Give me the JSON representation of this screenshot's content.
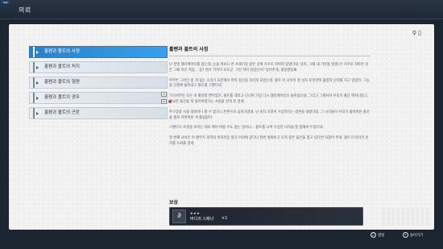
{
  "window": {
    "corner_tag": "▬▬",
    "title": "의뢰"
  },
  "header_icons": {
    "label": "⚲ ▯"
  },
  "nav": {
    "items": [
      {
        "label": "홀펜과 볼트의 사정",
        "active": true
      },
      {
        "label": "홀펜과 볼트의 처지",
        "active": false
      },
      {
        "label": "홀펜과 볼트의 형편",
        "active": false
      },
      {
        "label": "홀펜과 볼트의 경우",
        "active": false
      },
      {
        "label": "홀펜과 볼트의 곤란",
        "active": false
      }
    ]
  },
  "scroll_keys": {
    "up": "L2",
    "down": "R2"
  },
  "content": {
    "title": "홀펜과 볼트의 사정",
    "paragraphs": [
      "난 분명 델리베이터를 잡는데, 눈을 떠보니 한 쓰레기장 같은 곳에 거꾸로 처박혀 있었다네. 낭자, 그때 내 기분을 알겠나? 거꾸로 처박힌 것은 그때 이후 처음... 음? 뭔가 기억이 모호군. 그런 적이 있었던가? 잊어주게, 충정할일세.",
      "아무튼 그러던 중 개 짖는 소리가 요란해서 퍼뜩 정신을 차리게 되었는데, 볼트 이 녀석이 뭔 싱자 로봇한테 붙잡혀 난리를 치고 있었어. 그놈을 단칼에 쓸어내고 볼트를 구했다네.",
      "거기서부턴 모든 게 황당할 뿐이었지. 볼트를 데리고 다니며 거닐 다시 델리베이터로 돌아왔다네. 그리고 그제서야 우리가 줄단 뛰쳐나왔고, 중요한 물건을 죄 잃어버렸다는 사실을 알게 된 걸세.",
      "주구장창 사정 설명이나 할 수 없으니 본론으로 넘어가겠네. 난 싱자 로봇이 수상하다는 결론을 내렸다네. 그 녀석들이 우리가 잃어버린 물건을 훔쳐 치워버린 게 틀림없어.",
      "그렇다고 로봇을 보이는 대로 베어 버릴 수도 없는 일이니... 볼트를 시켜 수상한 녀석을 잘 찾해야 두었다네.",
      "첫 번째 녀석은 이 황무지 북쪽의 머지러운 협곡 어귀에 있다니 한번 살펴보고 모처 같은 물건을 찾고 있다면 되찾아 주게. 볼트가 따라가 낭자를 도와줄 걸세."
    ]
  },
  "reward": {
    "heading": "보상",
    "icon": "∂",
    "stars": "★★★",
    "name": "버디귀 스패너",
    "count": "×1"
  },
  "footer": {
    "confirm_key": "◯",
    "confirm_label": "결정",
    "back_key": "✕",
    "back_label": "돌아가기"
  }
}
